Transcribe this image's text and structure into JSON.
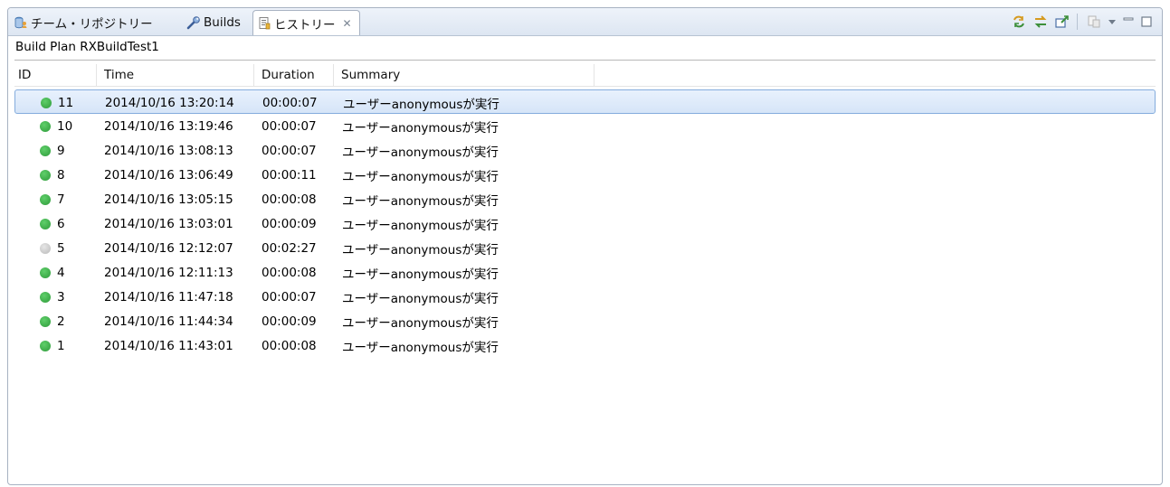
{
  "tabs": [
    {
      "label": "チーム・リポジトリー",
      "icon": "team-repository-icon",
      "active": false
    },
    {
      "label": "Builds",
      "icon": "wrench-icon",
      "active": false
    },
    {
      "label": "ヒストリー",
      "icon": "history-icon",
      "active": true,
      "close_icon": "close-icon"
    }
  ],
  "toolbar": {
    "icons": [
      "refresh-icon",
      "sync-icon",
      "export-icon",
      "disabled-action-icon",
      "view-menu-icon",
      "minimize-icon",
      "maximize-icon"
    ]
  },
  "plan_label": "Build Plan RXBuildTest1",
  "table": {
    "columns": [
      "ID",
      "Time",
      "Duration",
      "Summary"
    ],
    "rows": [
      {
        "id": "11",
        "status": "success",
        "time": "2014/10/16 13:20:14",
        "duration": "00:00:07",
        "summary": "ユーザーanonymousが実行",
        "selected": true
      },
      {
        "id": "10",
        "status": "success",
        "time": "2014/10/16 13:19:46",
        "duration": "00:00:07",
        "summary": "ユーザーanonymousが実行"
      },
      {
        "id": "9",
        "status": "success",
        "time": "2014/10/16 13:08:13",
        "duration": "00:00:07",
        "summary": "ユーザーanonymousが実行"
      },
      {
        "id": "8",
        "status": "success",
        "time": "2014/10/16 13:06:49",
        "duration": "00:00:11",
        "summary": "ユーザーanonymousが実行"
      },
      {
        "id": "7",
        "status": "success",
        "time": "2014/10/16 13:05:15",
        "duration": "00:00:08",
        "summary": "ユーザーanonymousが実行"
      },
      {
        "id": "6",
        "status": "success",
        "time": "2014/10/16 13:03:01",
        "duration": "00:00:09",
        "summary": "ユーザーanonymousが実行"
      },
      {
        "id": "5",
        "status": "none",
        "time": "2014/10/16 12:12:07",
        "duration": "00:02:27",
        "summary": "ユーザーanonymousが実行"
      },
      {
        "id": "4",
        "status": "success",
        "time": "2014/10/16 12:11:13",
        "duration": "00:00:08",
        "summary": "ユーザーanonymousが実行"
      },
      {
        "id": "3",
        "status": "success",
        "time": "2014/10/16 11:47:18",
        "duration": "00:00:07",
        "summary": "ユーザーanonymousが実行"
      },
      {
        "id": "2",
        "status": "success",
        "time": "2014/10/16 11:44:34",
        "duration": "00:00:09",
        "summary": "ユーザーanonymousが実行"
      },
      {
        "id": "1",
        "status": "success",
        "time": "2014/10/16 11:43:01",
        "duration": "00:00:08",
        "summary": "ユーザーanonymousが実行"
      }
    ]
  },
  "colors": {
    "success": "#3aa845",
    "none": "#c8c8c8",
    "selection": "#d6e5f8"
  }
}
